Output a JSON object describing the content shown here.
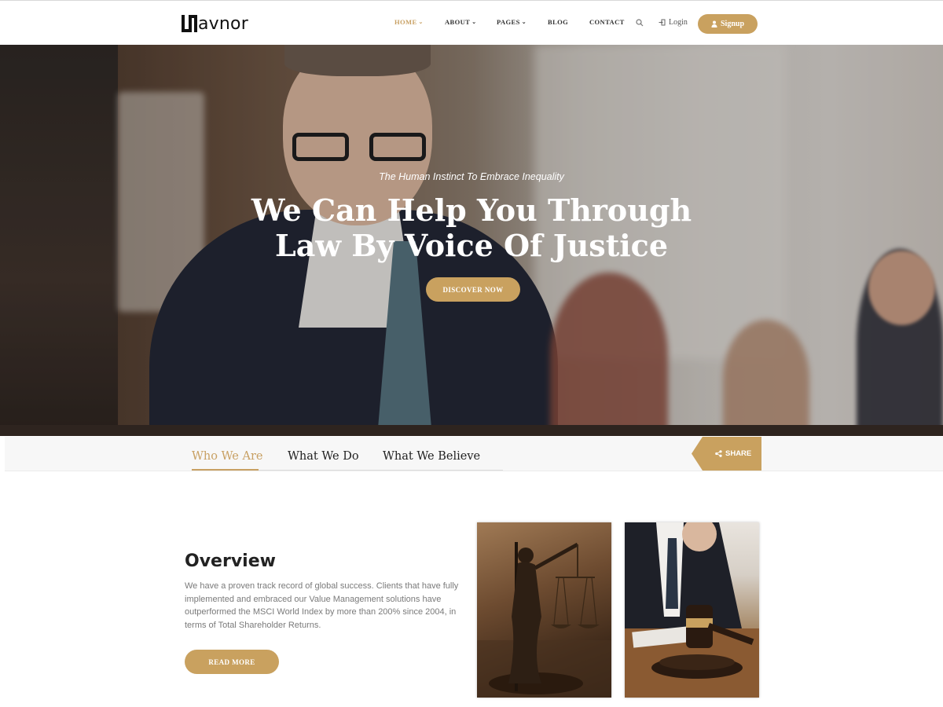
{
  "brand": {
    "name": "avnor"
  },
  "nav": {
    "items": [
      {
        "label": "HOME",
        "active": true,
        "dropdown": true
      },
      {
        "label": "ABOUT",
        "active": false,
        "dropdown": true
      },
      {
        "label": "PAGES",
        "active": false,
        "dropdown": true
      },
      {
        "label": "BLOG",
        "active": false,
        "dropdown": false
      },
      {
        "label": "CONTACT",
        "active": false,
        "dropdown": false
      }
    ],
    "search_icon": "search-icon",
    "login_label": "Login",
    "signup_label": "Signup"
  },
  "hero": {
    "tagline": "The Human Instinct To Embrace Inequality",
    "title": "We Can Help You Through Law By Voice Of Justice",
    "cta_label": "DISCOVER NOW"
  },
  "tabs": {
    "items": [
      {
        "label": "Who We Are",
        "active": true
      },
      {
        "label": "What We Do",
        "active": false
      },
      {
        "label": "What We Believe",
        "active": false
      }
    ],
    "share_label": "SHARE"
  },
  "overview": {
    "title": "Overview",
    "text": "We have a proven track record of global success. Clients that have fully implemented and embraced our Value Management solutions have outperformed the MSCI World Index by more than 200% since 2004, in terms of Total Shareholder Returns.",
    "button_label": "READ MORE"
  },
  "colors": {
    "accent": "#c9a15f",
    "text_dark": "#222222",
    "text_muted": "#7a7a7a"
  }
}
